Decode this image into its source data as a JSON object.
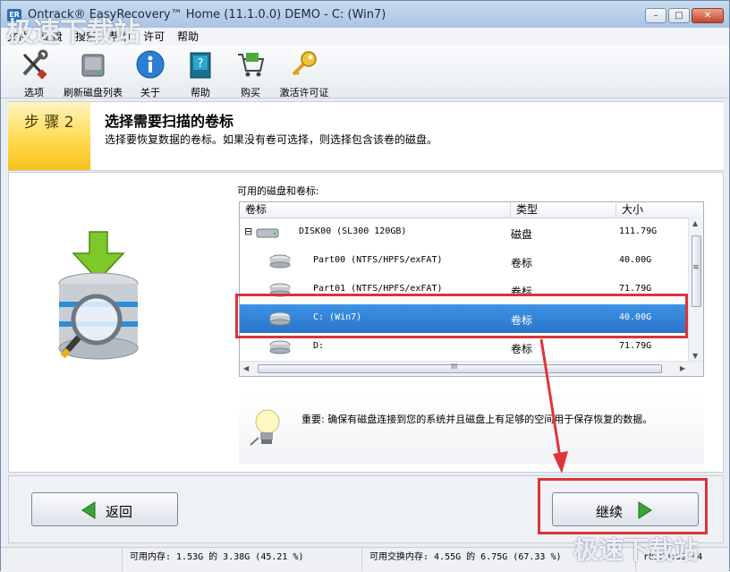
{
  "window": {
    "title": "Ontrack® EasyRecovery™ Home (11.1.0.0) DEMO - C: (Win7)",
    "icon_text": "ER",
    "controls": {
      "minimize": "–",
      "maximize": "□",
      "close": "✕"
    }
  },
  "menu": [
    "文件",
    "磁盘",
    "搜索",
    "帮助",
    "许可",
    "帮助"
  ],
  "toolbar": [
    {
      "label": "选项",
      "icon": "wrench-screwdriver-icon"
    },
    {
      "label": "刷新磁盘列表",
      "icon": "hard-drive-icon"
    },
    {
      "label": "关于",
      "icon": "info-icon"
    },
    {
      "label": "帮助",
      "icon": "help-book-icon"
    },
    {
      "label": "购买",
      "icon": "shopping-cart-icon"
    },
    {
      "label": "激活许可证",
      "icon": "key-icon"
    }
  ],
  "step": {
    "label": "步 骤  2",
    "title": "选择需要扫描的卷标",
    "description": "选择要恢复数据的卷标。如果没有卷可选择，则选择包含该卷的磁盘。"
  },
  "volumes": {
    "label": "可用的磁盘和卷标:",
    "columns": [
      "卷标",
      "类型",
      "大小"
    ],
    "rows": [
      {
        "name": "DISK00 (SL300 120GB)",
        "type": "磁盘",
        "size": "111.79G",
        "level": 0,
        "selected": false
      },
      {
        "name": "Part00 (NTFS/HPFS/exFAT)",
        "type": "卷标",
        "size": "40.00G",
        "level": 1,
        "selected": false
      },
      {
        "name": "Part01 (NTFS/HPFS/exFAT)",
        "type": "卷标",
        "size": "71.79G",
        "level": 1,
        "selected": false
      },
      {
        "name": "C: (Win7)",
        "type": "卷标",
        "size": "40.00G",
        "level": 1,
        "selected": true
      },
      {
        "name": "D:",
        "type": "卷标",
        "size": "71.79G",
        "level": 1,
        "selected": false
      }
    ],
    "expand_glyph": "⊟",
    "hscroll_grip": "III",
    "vscroll_grip": "≡"
  },
  "hint": {
    "text": "重要: 确保有磁盘连接到您的系统并且磁盘上有足够的空间用于保存恢复的数据。"
  },
  "buttons": {
    "back": "返回",
    "continue": "继续"
  },
  "status": {
    "memory": "可用内存: 1.53G 的 3.38G (45.21 %)",
    "swap": "可用交换内存: 4.55G 的 6.75G (67.33 %)",
    "build": "r8350:09.44"
  },
  "watermark": "极速下载站",
  "colors": {
    "accent": "#2a74c8",
    "highlight": "#d9343b",
    "step_badge": "#ffd84a"
  }
}
